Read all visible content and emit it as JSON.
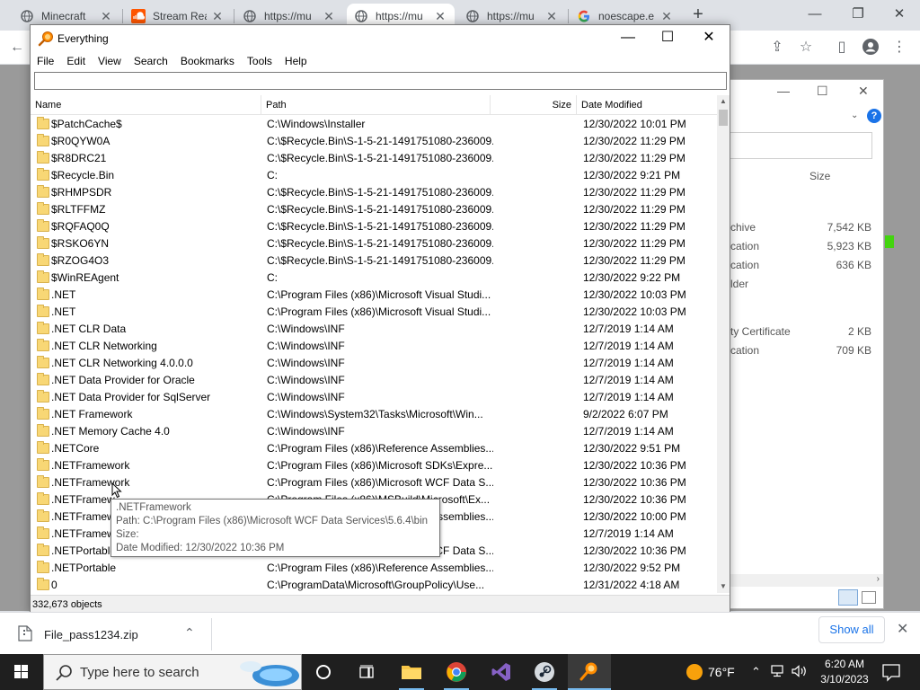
{
  "browser": {
    "tabs": [
      {
        "label": "Minecraft",
        "icon": "globe-icon"
      },
      {
        "label": "Stream Rea",
        "icon": "soundcloud-icon"
      },
      {
        "label": "https://mu",
        "icon": "globe-icon"
      },
      {
        "label": "https://mu",
        "icon": "globe-icon",
        "active": true
      },
      {
        "label": "https://mu",
        "icon": "globe-icon"
      },
      {
        "label": "noescape.e",
        "icon": "google-icon"
      }
    ],
    "new_tab": "+",
    "download": {
      "filename": "File_pass1234.zip"
    },
    "show_all": "Show all"
  },
  "everything": {
    "title": "Everything",
    "menu": [
      "File",
      "Edit",
      "View",
      "Search",
      "Bookmarks",
      "Tools",
      "Help"
    ],
    "search_value": "",
    "columns": {
      "name": "Name",
      "path": "Path",
      "size": "Size",
      "date": "Date Modified"
    },
    "rows": [
      {
        "name": "$PatchCache$",
        "path": "C:\\Windows\\Installer",
        "date": "12/30/2022 10:01 PM"
      },
      {
        "name": "$R0QYW0A",
        "path": "C:\\$Recycle.Bin\\S-1-5-21-1491751080-236009...",
        "date": "12/30/2022 11:29 PM"
      },
      {
        "name": "$R8DRC21",
        "path": "C:\\$Recycle.Bin\\S-1-5-21-1491751080-236009...",
        "date": "12/30/2022 11:29 PM"
      },
      {
        "name": "$Recycle.Bin",
        "path": "C:",
        "date": "12/30/2022 9:21 PM"
      },
      {
        "name": "$RHMPSDR",
        "path": "C:\\$Recycle.Bin\\S-1-5-21-1491751080-236009...",
        "date": "12/30/2022 11:29 PM"
      },
      {
        "name": "$RLTFFMZ",
        "path": "C:\\$Recycle.Bin\\S-1-5-21-1491751080-236009...",
        "date": "12/30/2022 11:29 PM"
      },
      {
        "name": "$RQFAQ0Q",
        "path": "C:\\$Recycle.Bin\\S-1-5-21-1491751080-236009...",
        "date": "12/30/2022 11:29 PM"
      },
      {
        "name": "$RSKO6YN",
        "path": "C:\\$Recycle.Bin\\S-1-5-21-1491751080-236009...",
        "date": "12/30/2022 11:29 PM"
      },
      {
        "name": "$RZOG4O3",
        "path": "C:\\$Recycle.Bin\\S-1-5-21-1491751080-236009...",
        "date": "12/30/2022 11:29 PM"
      },
      {
        "name": "$WinREAgent",
        "path": "C:",
        "date": "12/30/2022 9:22 PM"
      },
      {
        "name": ".NET",
        "path": "C:\\Program Files (x86)\\Microsoft Visual Studi...",
        "date": "12/30/2022 10:03 PM"
      },
      {
        "name": ".NET",
        "path": "C:\\Program Files (x86)\\Microsoft Visual Studi...",
        "date": "12/30/2022 10:03 PM"
      },
      {
        "name": ".NET CLR Data",
        "path": "C:\\Windows\\INF",
        "date": "12/7/2019 1:14 AM"
      },
      {
        "name": ".NET CLR Networking",
        "path": "C:\\Windows\\INF",
        "date": "12/7/2019 1:14 AM"
      },
      {
        "name": ".NET CLR Networking 4.0.0.0",
        "path": "C:\\Windows\\INF",
        "date": "12/7/2019 1:14 AM"
      },
      {
        "name": ".NET Data Provider for Oracle",
        "path": "C:\\Windows\\INF",
        "date": "12/7/2019 1:14 AM"
      },
      {
        "name": ".NET Data Provider for SqlServer",
        "path": "C:\\Windows\\INF",
        "date": "12/7/2019 1:14 AM"
      },
      {
        "name": ".NET Framework",
        "path": "C:\\Windows\\System32\\Tasks\\Microsoft\\Win...",
        "date": "9/2/2022 6:07 PM"
      },
      {
        "name": ".NET Memory Cache 4.0",
        "path": "C:\\Windows\\INF",
        "date": "12/7/2019 1:14 AM"
      },
      {
        "name": ".NETCore",
        "path": "C:\\Program Files (x86)\\Reference Assemblies...",
        "date": "12/30/2022 9:51 PM"
      },
      {
        "name": ".NETFramework",
        "path": "C:\\Program Files (x86)\\Microsoft SDKs\\Expre...",
        "date": "12/30/2022 10:36 PM"
      },
      {
        "name": ".NETFramework",
        "path": "C:\\Program Files (x86)\\Microsoft WCF Data S...",
        "date": "12/30/2022 10:36 PM"
      },
      {
        "name": ".NETFramew",
        "path": "C:\\Program Files (x86)\\MSBuild\\Microsoft\\Ex...",
        "date": "12/30/2022 10:36 PM"
      },
      {
        "name": ".NETFramew",
        "path": "C:\\Program Files (x86)\\Reference Assemblies...",
        "date": "12/30/2022 10:00 PM"
      },
      {
        "name": ".NETFramew",
        "path": "C:\\Windows\\INF",
        "date": "12/7/2019 1:14 AM"
      },
      {
        "name": ".NETPortable",
        "path": "C:\\Program Files (x86)\\Microsoft WCF Data S...",
        "date": "12/30/2022 10:36 PM"
      },
      {
        "name": ".NETPortable",
        "path": "C:\\Program Files (x86)\\Reference Assemblies...",
        "date": "12/30/2022 9:52 PM"
      },
      {
        "name": "0",
        "path": "C:\\ProgramData\\Microsoft\\GroupPolicy\\Use...",
        "date": "12/31/2022 4:18 AM"
      }
    ],
    "tooltip": {
      "name": ".NETFramework",
      "path": "Path: C:\\Program Files (x86)\\Microsoft WCF Data Services\\5.6.4\\bin",
      "size": "Size:",
      "date": "Date Modified: 12/30/2022 10:36 PM"
    },
    "status": "332,673 objects"
  },
  "background_window": {
    "size_header": "Size",
    "rows": [
      {
        "type": "chive",
        "size": "7,542 KB"
      },
      {
        "type": "cation",
        "size": "5,923 KB"
      },
      {
        "type": "cation",
        "size": "636 KB"
      },
      {
        "type": "lder",
        "size": ""
      },
      {
        "type": "ty Certificate",
        "size": "2 KB"
      },
      {
        "type": "cation",
        "size": "709 KB"
      }
    ]
  },
  "taskbar": {
    "search_placeholder": "Type here to search",
    "weather": "76°F",
    "time": "6:20 AM",
    "date": "3/10/2023"
  }
}
